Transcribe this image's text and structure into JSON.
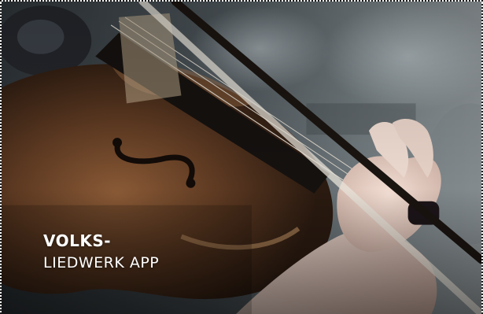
{
  "banner": {
    "title_line1": "VOLKS-",
    "title_line2": "LIEDWERK APP",
    "image_subject": "violin-playing-photo"
  },
  "colors": {
    "title_text": "#ffffff",
    "border": "#1a1a1a"
  }
}
